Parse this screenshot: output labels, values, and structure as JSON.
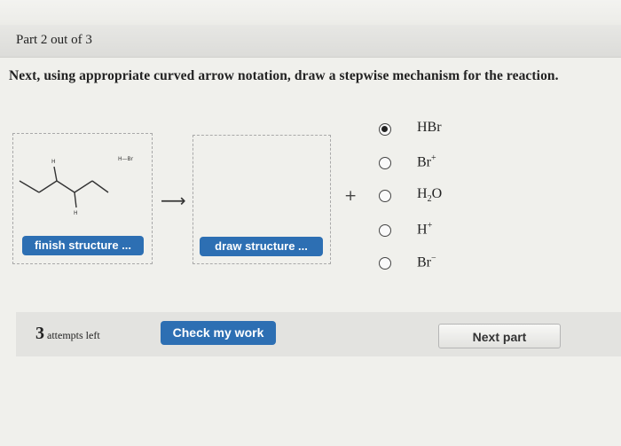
{
  "header": {
    "part_title": "Part 2 out of 3"
  },
  "question": {
    "text": "Next, using appropriate curved arrow notation, draw a stepwise mechanism for the reaction."
  },
  "reaction": {
    "box1": {
      "hbr_label": "H—Br",
      "h_top": "H",
      "h_bottom": "H",
      "button_label": "finish structure ..."
    },
    "arrow": "⟶",
    "box2": {
      "button_label": "draw structure ..."
    },
    "plus": "+"
  },
  "options": [
    {
      "label": "HBr",
      "selected": true
    },
    {
      "label": "Br",
      "sup": "+",
      "selected": false
    },
    {
      "label": "H",
      "sub": "2",
      "tail": "O",
      "selected": false
    },
    {
      "label": "H",
      "sup": "+",
      "selected": false
    },
    {
      "label": "Br",
      "sup": "−",
      "selected": false
    }
  ],
  "footer": {
    "attempts_count": "3",
    "attempts_text": "attempts left",
    "check_label": "Check my work",
    "next_label": "Next part"
  },
  "colors": {
    "primary_button": "#2d6fb3",
    "background": "#f0f0ec"
  }
}
